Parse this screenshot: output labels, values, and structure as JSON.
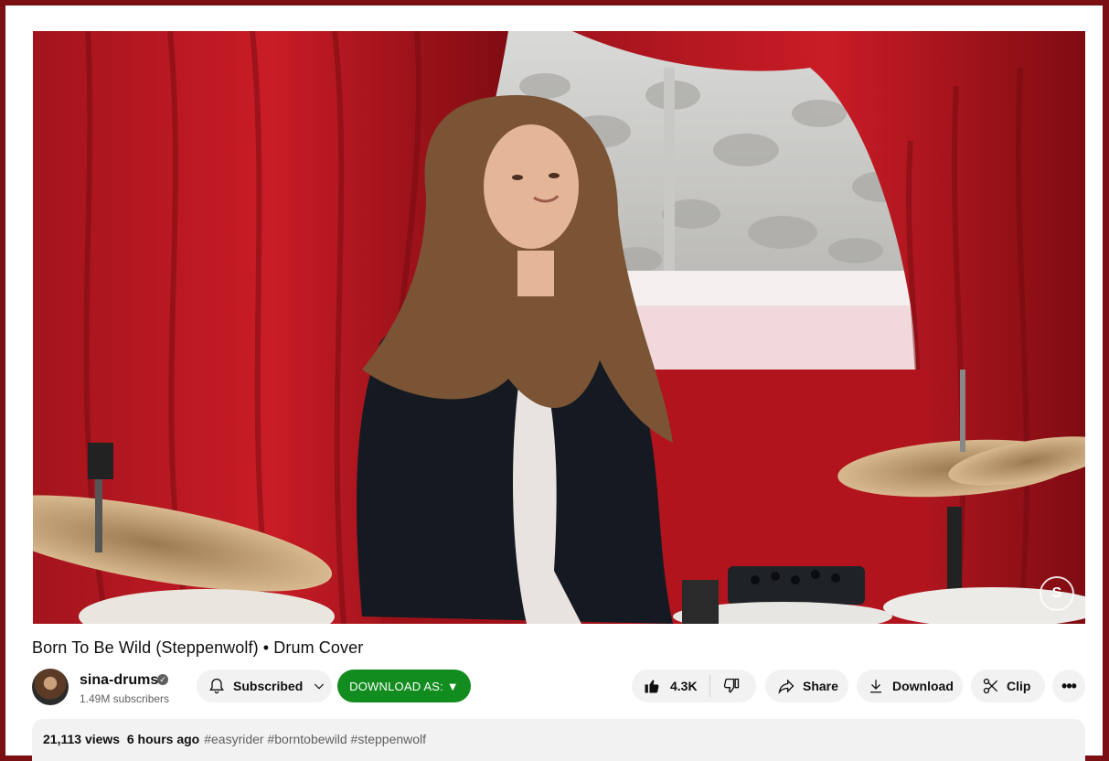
{
  "video": {
    "watermark": "S"
  },
  "title": "Born To Be Wild (Steppenwolf) • Drum Cover",
  "channel": {
    "name": "sina-drums",
    "verified_mark": "✓",
    "subscribers": "1.49M subscribers",
    "avatar_icon": "avatar"
  },
  "actions": {
    "subscribed_label": "Subscribed",
    "download_as_label": "DOWNLOAD AS: ▼",
    "like_count": "4.3K",
    "share_label": "Share",
    "download_label": "Download",
    "clip_label": "Clip",
    "more_label": "•••"
  },
  "description": {
    "views": "21,113 views",
    "age": "6 hours ago",
    "tags": "#easyrider #borntobewild #steppenwolf"
  },
  "colors": {
    "frame": "#7a0f14",
    "download_as_bg": "#128c1f",
    "pill_bg": "#f2f2f2"
  }
}
